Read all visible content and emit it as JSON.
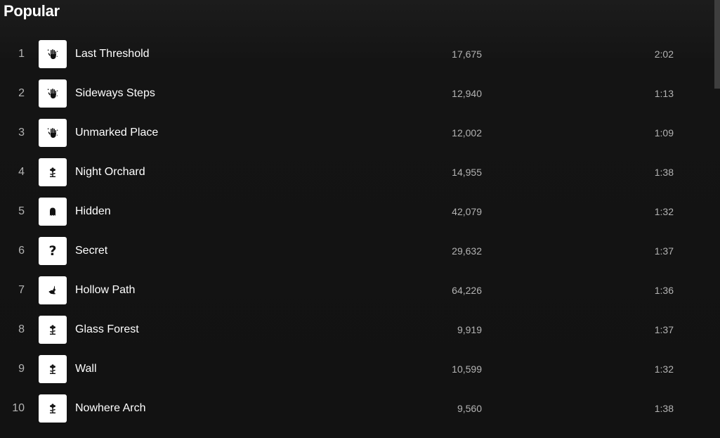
{
  "section": {
    "title": "Popular"
  },
  "tracks": [
    {
      "number": "1",
      "title": "Last Threshold",
      "plays": "17,675",
      "duration": "2:02",
      "icon": "hand-icon"
    },
    {
      "number": "2",
      "title": "Sideways Steps",
      "plays": "12,940",
      "duration": "1:13",
      "icon": "hand-icon"
    },
    {
      "number": "3",
      "title": "Unmarked Place",
      "plays": "12,002",
      "duration": "1:09",
      "icon": "hand-icon"
    },
    {
      "number": "4",
      "title": "Night Orchard",
      "plays": "14,955",
      "duration": "1:38",
      "icon": "flower-icon"
    },
    {
      "number": "5",
      "title": "Hidden",
      "plays": "42,079",
      "duration": "1:32",
      "icon": "ghost-icon"
    },
    {
      "number": "6",
      "title": "Secret",
      "plays": "29,632",
      "duration": "1:37",
      "icon": "question-mark-icon"
    },
    {
      "number": "7",
      "title": "Hollow Path",
      "plays": "64,226",
      "duration": "1:36",
      "icon": "rabbit-icon"
    },
    {
      "number": "8",
      "title": "Glass Forest",
      "plays": "9,919",
      "duration": "1:37",
      "icon": "flower-icon"
    },
    {
      "number": "9",
      "title": "Wall",
      "plays": "10,599",
      "duration": "1:32",
      "icon": "flower-icon"
    },
    {
      "number": "10",
      "title": "Nowhere Arch",
      "plays": "9,560",
      "duration": "1:38",
      "icon": "flower-icon"
    }
  ],
  "colors": {
    "background": "#121212",
    "primary_text": "#ffffff",
    "secondary_text": "#b3b3b3",
    "artwork_background": "#ffffff"
  }
}
